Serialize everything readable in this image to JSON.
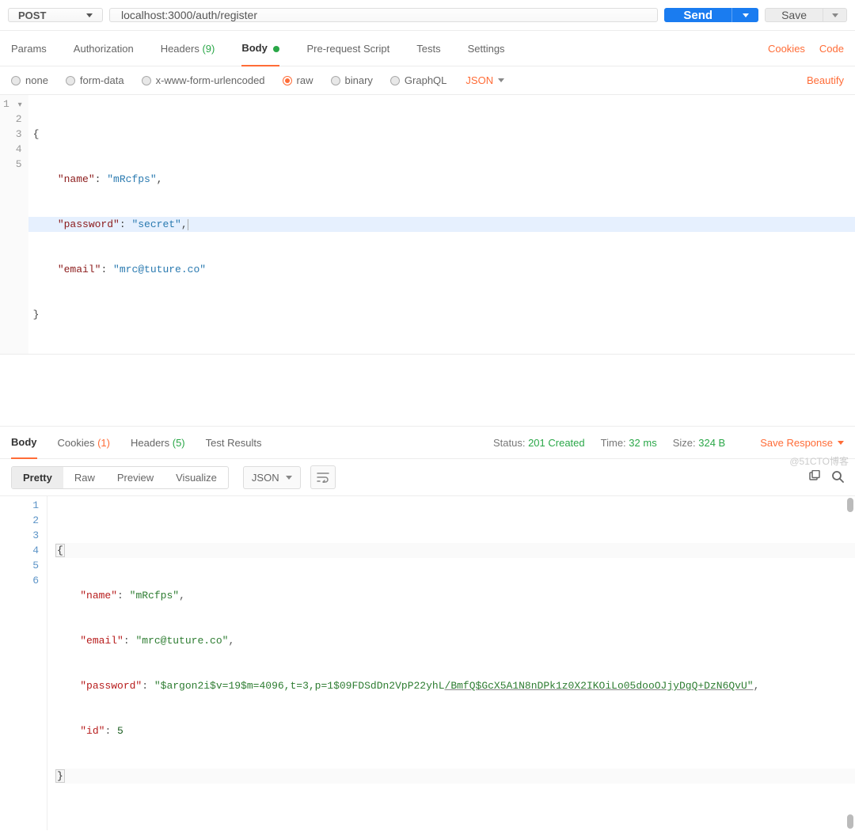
{
  "request": {
    "method": "POST",
    "url": "localhost:3000/auth/register",
    "send_label": "Send",
    "save_label": "Save"
  },
  "tabs": {
    "params": "Params",
    "authorization": "Authorization",
    "headers": "Headers",
    "headers_count": "(9)",
    "body": "Body",
    "prerequest": "Pre-request Script",
    "tests": "Tests",
    "settings": "Settings",
    "cookies": "Cookies",
    "code": "Code"
  },
  "body_types": {
    "none": "none",
    "formdata": "form-data",
    "urlencoded": "x-www-form-urlencoded",
    "raw": "raw",
    "binary": "binary",
    "graphql": "GraphQL",
    "language": "JSON",
    "beautify": "Beautify"
  },
  "request_json": {
    "ln1": {
      "br": "{"
    },
    "ln2": {
      "key": "\"name\"",
      "sep": ": ",
      "val": "\"mRcfps\"",
      "end": ","
    },
    "ln3": {
      "key": "\"password\"",
      "sep": ": ",
      "val": "\"secret\"",
      "end": ","
    },
    "ln4": {
      "key": "\"email\"",
      "sep": ": ",
      "val": "\"mrc@tuture.co\"",
      "end": ""
    },
    "ln5": {
      "br": "}"
    }
  },
  "response_tabs": {
    "body": "Body",
    "cookies": "Cookies",
    "cookies_count": "(1)",
    "headers": "Headers",
    "headers_count": "(5)",
    "tests": "Test Results"
  },
  "response_meta": {
    "status_label": "Status:",
    "status_value": "201 Created",
    "time_label": "Time:",
    "time_value": "32 ms",
    "size_label": "Size:",
    "size_value": "324 B",
    "save_response": "Save Response"
  },
  "response_controls": {
    "pretty": "Pretty",
    "raw": "Raw",
    "preview": "Preview",
    "visualize": "Visualize",
    "language": "JSON"
  },
  "response_json": {
    "ln1": {
      "br": "{"
    },
    "ln2": {
      "key": "\"name\"",
      "sep": ": ",
      "val": "\"mRcfps\"",
      "end": ","
    },
    "ln3": {
      "key": "\"email\"",
      "sep": ": ",
      "val": "\"mrc@tuture.co\"",
      "end": ","
    },
    "ln4": {
      "key": "\"password\"",
      "sep": ": ",
      "val_a": "\"$argon2i$v=19$m=4096,t=3,p=1$09FDSdDn2VpP22yhL",
      "val_b": "/BmfQ$GcX5A1N8nDPk1z0X2IKOiLo05dooOJjyDgQ+DzN6QvU\"",
      "end": ","
    },
    "ln5": {
      "key": "\"id\"",
      "sep": ": ",
      "num": "5",
      "end": ""
    },
    "ln6": {
      "br": "}"
    }
  },
  "watermark": "@51CTO博客"
}
